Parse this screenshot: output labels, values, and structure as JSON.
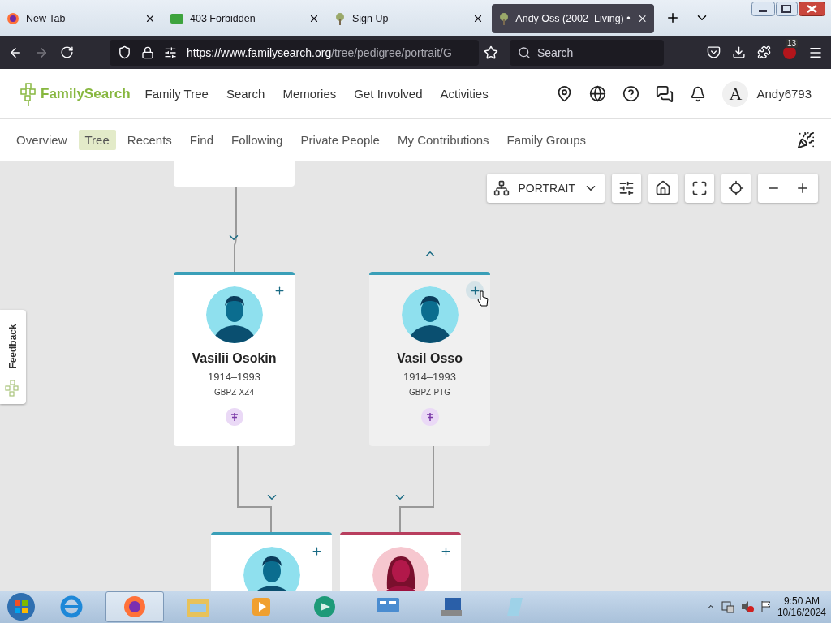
{
  "browser": {
    "tabs": [
      {
        "title": "New Tab",
        "selected": false
      },
      {
        "title": "403 Forbidden",
        "selected": false
      },
      {
        "title": "Sign Up",
        "selected": false
      },
      {
        "title": "Andy Oss (2002–Living) •",
        "selected": true
      }
    ],
    "url_host": "https://www.familysearch.org",
    "url_path": "/tree/pedigree/portrait/G",
    "search_placeholder": "Search",
    "extension_badge": "13"
  },
  "site": {
    "logo": "FamilySearch",
    "nav": [
      "Family Tree",
      "Search",
      "Memories",
      "Get Involved",
      "Activities"
    ],
    "user_initial": "A",
    "username": "Andy6793"
  },
  "subnav": [
    {
      "label": "Overview",
      "selected": false
    },
    {
      "label": "Tree",
      "selected": true
    },
    {
      "label": "Recents",
      "selected": false
    },
    {
      "label": "Find",
      "selected": false
    },
    {
      "label": "Following",
      "selected": false
    },
    {
      "label": "Private People",
      "selected": false
    },
    {
      "label": "My Contributions",
      "selected": false
    },
    {
      "label": "Family Groups",
      "selected": false
    }
  ],
  "view_menu": {
    "label": "PORTRAIT"
  },
  "feedback": "Feedback",
  "persons": [
    {
      "name": "Vasilii Osokin",
      "dates": "1914–1993",
      "pid": "GBPZ-XZ4",
      "kind": "male",
      "hovered": false
    },
    {
      "name": "Vasil Osso",
      "dates": "1914–1993",
      "pid": "GBPZ-PTG",
      "kind": "male",
      "hovered": true
    },
    {
      "kind": "male",
      "hovered": false
    },
    {
      "kind": "female",
      "hovered": false
    }
  ],
  "clock": {
    "time": "9:50 AM",
    "date": "10/16/2024"
  }
}
